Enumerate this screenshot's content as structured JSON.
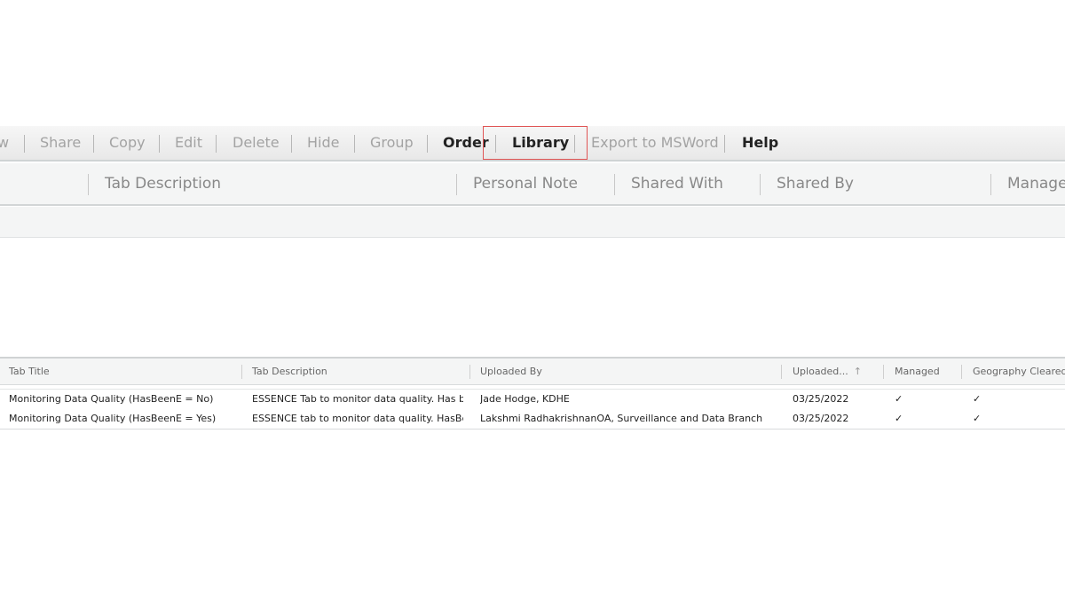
{
  "toolbar": {
    "items": [
      {
        "label": "w",
        "enabled": false
      },
      {
        "label": "Share",
        "enabled": false
      },
      {
        "label": "Copy",
        "enabled": false
      },
      {
        "label": "Edit",
        "enabled": false
      },
      {
        "label": "Delete",
        "enabled": false
      },
      {
        "label": "Hide",
        "enabled": false
      },
      {
        "label": "Group",
        "enabled": false
      },
      {
        "label": "Order",
        "enabled": true
      },
      {
        "label": "Library",
        "enabled": true
      },
      {
        "label": "Export to MSWord",
        "enabled": false
      },
      {
        "label": "Help",
        "enabled": true
      }
    ],
    "highlighted": "Library"
  },
  "tabs_grid": {
    "columns": [
      "Tab Description",
      "Personal Note",
      "Shared With",
      "Shared By",
      "Manage"
    ]
  },
  "library_grid": {
    "columns": [
      "Tab Title",
      "Tab Description",
      "Uploaded By",
      "Uploaded...",
      "Managed",
      "Geography Cleared"
    ],
    "sort_indicator": "↑",
    "rows": [
      {
        "title": "Monitoring Data Quality (HasBeenE = No)",
        "description": "ESSENCE Tab to monitor data quality. Has be...",
        "uploaded_by": "Jade Hodge, KDHE",
        "uploaded": "03/25/2022",
        "managed": "✓",
        "geography_cleared": "✓"
      },
      {
        "title": "Monitoring Data Quality (HasBeenE = Yes)",
        "description": "ESSENCE tab to monitor data quality. HasBee...",
        "uploaded_by": "Lakshmi RadhakrishnanOA, Surveillance and Data Branch",
        "uploaded": "03/25/2022",
        "managed": "✓",
        "geography_cleared": "✓"
      }
    ]
  },
  "colors": {
    "highlight_border": "#e05555",
    "disabled_text": "#a3a3a3",
    "enabled_text": "#222222"
  }
}
